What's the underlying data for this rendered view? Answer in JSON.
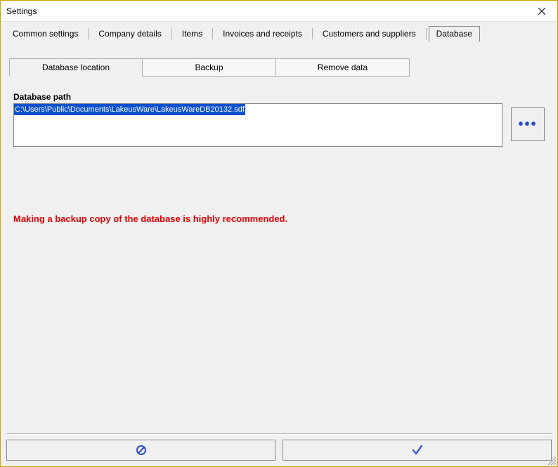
{
  "window": {
    "title": "Settings"
  },
  "tabs": {
    "items": [
      {
        "label": "Common settings"
      },
      {
        "label": "Company details"
      },
      {
        "label": "Items"
      },
      {
        "label": "Invoices and receipts"
      },
      {
        "label": "Customers and suppliers"
      },
      {
        "label": "Database"
      }
    ],
    "active_index": 5
  },
  "subtabs": {
    "items": [
      {
        "label": "Database location"
      },
      {
        "label": "Backup"
      },
      {
        "label": "Remove data"
      }
    ],
    "active_index": 0
  },
  "database": {
    "path_label": "Database path",
    "path_value": "C:\\Users\\Public\\Documents\\LakeusWare\\LakeusWareDB20132.sdf",
    "browse_glyph": "•••",
    "warning": "Making a backup copy of the database is highly recommended."
  },
  "colors": {
    "selection_bg": "#0a50d0",
    "warning_text": "#e00000",
    "accent_blue": "#2a4bd7"
  }
}
